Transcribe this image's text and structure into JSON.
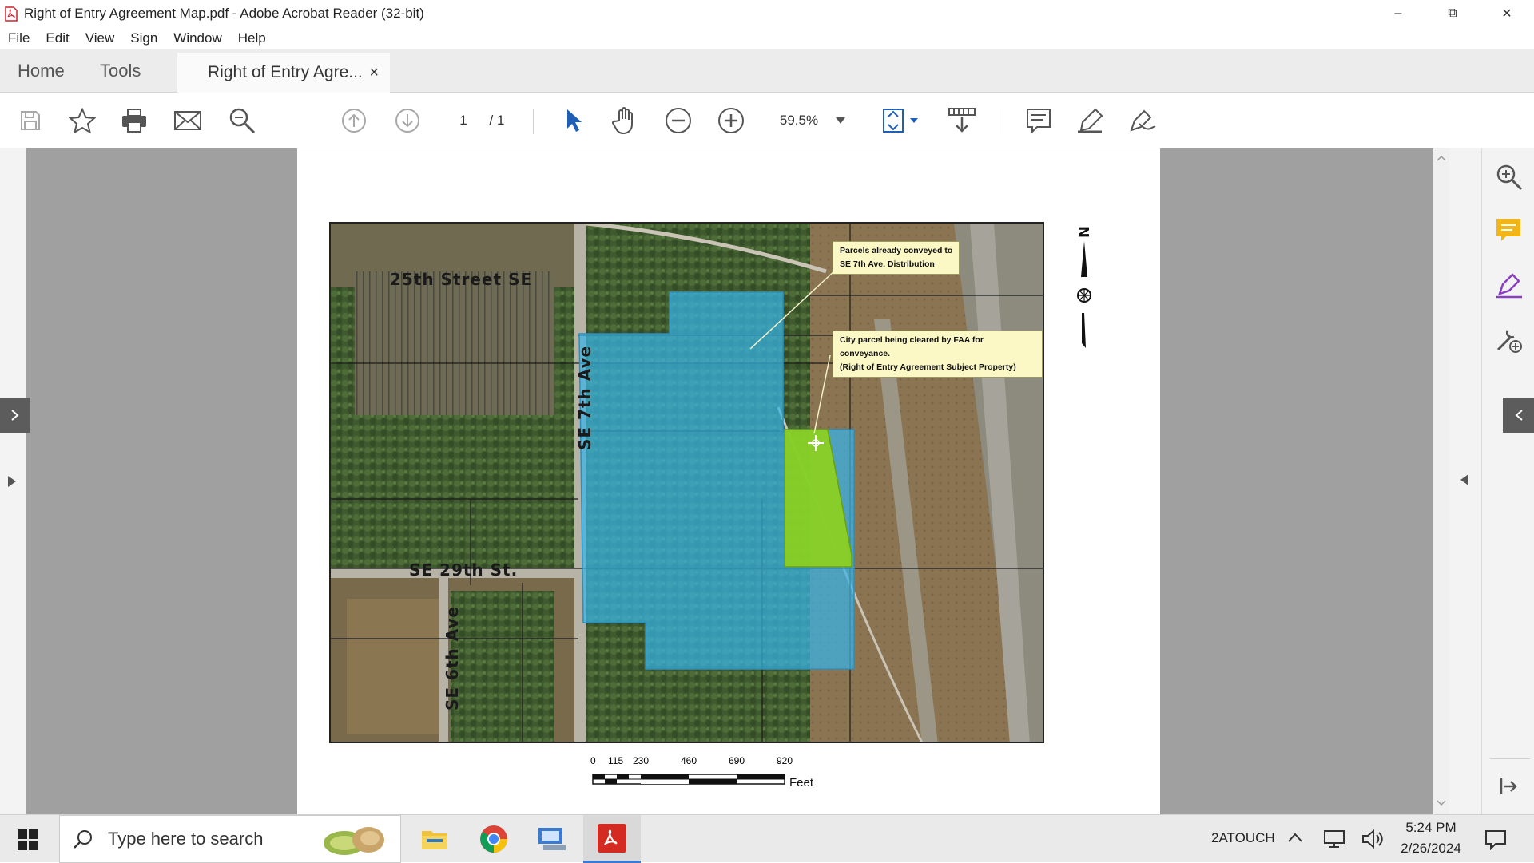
{
  "window": {
    "title": "Right of Entry Agreement Map.pdf - Adobe Acrobat Reader (32-bit)",
    "minimize_label": "–",
    "restore_label": "⧉",
    "close_label": "✕"
  },
  "menu": {
    "items": [
      "File",
      "Edit",
      "View",
      "Sign",
      "Window",
      "Help"
    ]
  },
  "tabs": {
    "home": "Home",
    "tools": "Tools",
    "document": "Right of Entry Agre...",
    "close": "×"
  },
  "toolbar": {
    "page_current": "1",
    "page_total": "/ 1",
    "zoom": "59.5%"
  },
  "map": {
    "labels": {
      "street_25th": "25th Street SE",
      "street_29th": "SE 29th St.",
      "ave_7th": "SE 7th Ave",
      "ave_6th": "SE 6th Ave"
    },
    "callout_conveyed": [
      "Parcels already conveyed to",
      "SE 7th Ave. Distribution"
    ],
    "callout_city": [
      "City parcel being cleared by FAA for conveyance.",
      "(Right of Entry Agreement Subject Property)"
    ],
    "north_label": "N",
    "colors": {
      "conveyed_parcel": "#38b4e6",
      "subject_parcel": "#8ed21a",
      "callout_bg": "#fbf8c6"
    }
  },
  "scale_bar": {
    "ticks": [
      "0",
      "115",
      "230",
      "460",
      "690",
      "920"
    ],
    "unit": "Feet"
  },
  "taskbar": {
    "search_placeholder": "Type here to search",
    "tray_label": "2ATOUCH",
    "time": "5:24 PM",
    "date": "2/26/2024"
  }
}
